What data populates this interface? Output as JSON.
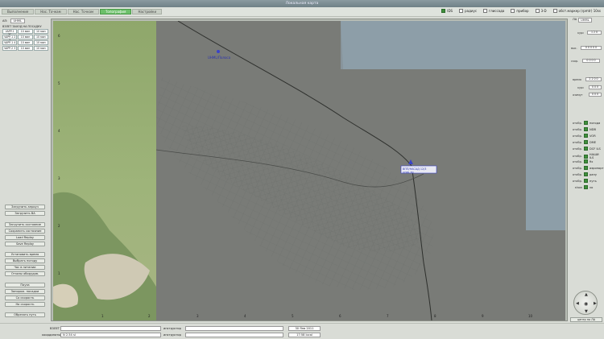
{
  "window": {
    "title": "Локальная карта"
  },
  "tabs": [
    {
      "label": "Выполнение",
      "active": false
    },
    {
      "label": "Нас. Точкам",
      "active": false
    },
    {
      "label": "Нас. Точкам",
      "active": false
    },
    {
      "label": "Топография",
      "active": true
    },
    {
      "label": "Настройки",
      "active": false
    }
  ],
  "toggles": [
    {
      "label": "IDS",
      "checked": true
    },
    {
      "label": "радиус",
      "checked": false
    },
    {
      "label": "глиссада",
      "checked": false
    },
    {
      "label": "прибор",
      "checked": false
    },
    {
      "label": "3-D",
      "checked": false
    },
    {
      "label": "обст.маркер (rpmtr) 10ss",
      "checked": false
    }
  ],
  "left_panel": {
    "airport_label": "АП:",
    "airport_value": "UHML",
    "section_title": "ВЗЛЕТ   ЗАХОД НА ПОСАДКУ",
    "matrix": [
      [
        "VAPP-1 3C",
        "10 мин",
        "10 мин"
      ],
      [
        "VAPP-1 2 3",
        "10 мин",
        "10 мин"
      ],
      [
        "VAPP-1 4",
        "10 мин",
        "10 мин"
      ],
      [
        "VAPP-2 3",
        "10 мин",
        "10 мин"
      ]
    ],
    "buttons": [
      "Загрузить апроуч",
      "Загрузить ВА",
      "Загрузить состояние",
      "Сохранить состояние",
      "Load Replay",
      "Save Replay",
      "Установить время",
      "Выбрать погоду",
      "Час в питании",
      "Отказы оборудов.",
      "Пауза",
      "Запорож. посадки",
      "Со скорость",
      "На скорость",
      "Обрезать путь",
      "Загрузить ВП",
      "Выключить всё"
    ]
  },
  "map": {
    "labels": {
      "vor_a": "UHML/Полоса",
      "vor_b": "ВПП/НАСАД 12/3",
      "vor_b2": "UHML 80"
    },
    "x_ticks": [
      "1",
      "2",
      "3",
      "4",
      "5",
      "6",
      "7",
      "8",
      "9",
      "10"
    ],
    "y_ticks": [
      "6",
      "5",
      "4",
      "3",
      "2",
      "1"
    ]
  },
  "right_panel": {
    "top_label": "ЛА",
    "top_value": "UHML",
    "fields": [
      {
        "label": "курс",
        "value": "1 2 0"
      },
      {
        "label": "выс.",
        "value": "0 0 0 0 0"
      },
      {
        "label": "скор.",
        "value": "0 0 0 0"
      },
      {
        "label": "время",
        "value": "2 2 0 0"
      },
      {
        "label": "курс",
        "value": "0 0 0"
      },
      {
        "label": "азимут",
        "value": "0 0 0"
      }
    ],
    "layers": [
      {
        "k": "отобр.",
        "name": "погода",
        "checked": true
      },
      {
        "k": "отобр.",
        "name": "NDB",
        "checked": true
      },
      {
        "k": "отобр.",
        "name": "VOR",
        "checked": true
      },
      {
        "k": "отобр.",
        "name": "DME",
        "checked": true
      },
      {
        "k": "отобр.",
        "name": "DCF ILS",
        "checked": true
      },
      {
        "k": "отобр.",
        "name": "НАШИ ILS",
        "checked": true
      },
      {
        "k": "отобр.",
        "name": "fix",
        "checked": true
      },
      {
        "k": "отобр.",
        "name": "аэропорт",
        "checked": true
      },
      {
        "k": "отобр.",
        "name": "рану",
        "checked": true
      },
      {
        "k": "отобр.",
        "name": "путь",
        "checked": true
      },
      {
        "k": "show",
        "name": "vo",
        "checked": true
      }
    ],
    "nav_button": "центр по ЛА"
  },
  "bottom": {
    "label1": "ВЗЛЕТ",
    "label2": "координаты",
    "value2": "N 2.54 sl",
    "label3": "инструктор",
    "label4": "инструктор",
    "date": "30 Янв 2011",
    "time": "17:58 local"
  }
}
